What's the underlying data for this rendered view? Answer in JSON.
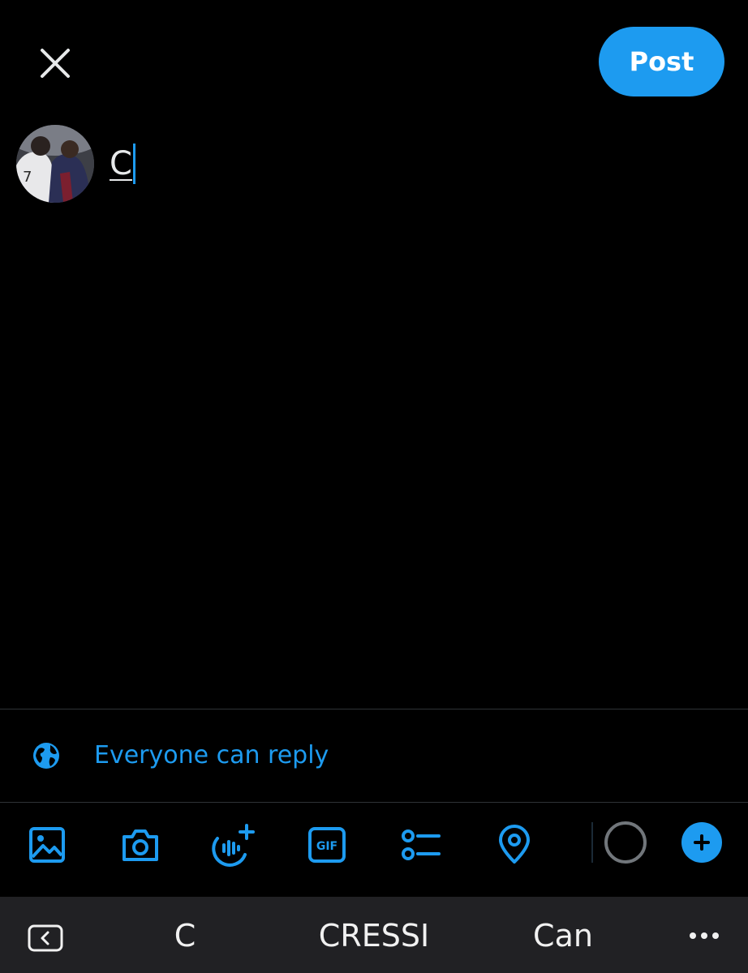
{
  "header": {
    "close_icon": "close-icon",
    "post_label": "Post"
  },
  "composer": {
    "avatar_icon": "profile-avatar",
    "text": "C"
  },
  "reply_setting": {
    "icon": "globe-icon",
    "label": "Everyone can reply"
  },
  "toolbar": {
    "icons": [
      "image-icon",
      "camera-icon",
      "spaces-icon",
      "gif-icon",
      "poll-icon",
      "location-icon",
      "character-counter-icon",
      "add-post-icon"
    ],
    "gif_text": "GIF"
  },
  "keyboard": {
    "suggestions": [
      "C",
      "CRESSI",
      "Can"
    ],
    "back_icon": "keyboard-back-icon",
    "more_icon": "more-icon"
  },
  "colors": {
    "accent": "#1d9bf0",
    "background": "#000000",
    "keyboard_bar": "#212124"
  }
}
